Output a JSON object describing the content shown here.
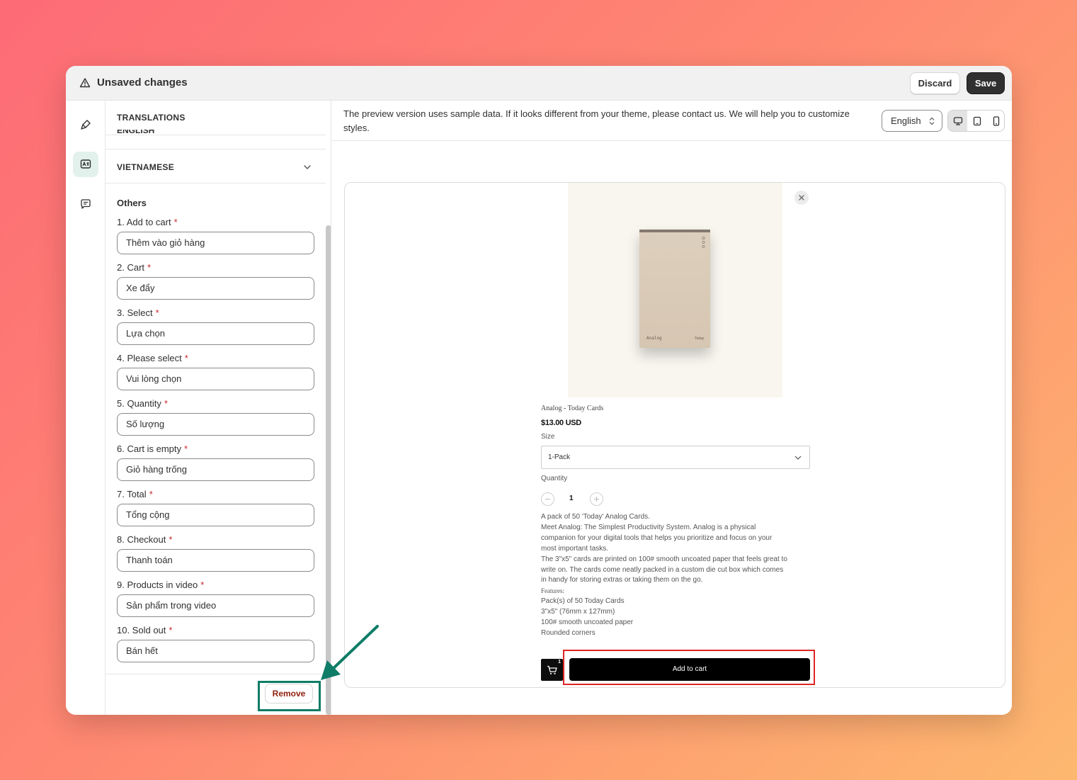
{
  "topbar": {
    "title": "Unsaved changes",
    "discard_label": "Discard",
    "save_label": "Save"
  },
  "rail": {
    "items": [
      {
        "icon": "paintbrush-icon",
        "active": false
      },
      {
        "icon": "translate-icon",
        "active": true
      },
      {
        "icon": "chat-icon",
        "active": false
      }
    ]
  },
  "panel": {
    "heading": "TRANSLATIONS",
    "collapsed_section": "ENGLISH",
    "section": "VIETNAMESE",
    "group_title": "Others",
    "fields": [
      {
        "label": "1. Add to cart",
        "value": "Thêm vào giỏ hàng"
      },
      {
        "label": "2. Cart",
        "value": "Xe đẩy"
      },
      {
        "label": "3. Select",
        "value": "Lựa chọn"
      },
      {
        "label": "4. Please select",
        "value": "Vui lòng chọn"
      },
      {
        "label": "5. Quantity",
        "value": "Số lượng"
      },
      {
        "label": "6. Cart is empty",
        "value": "Giỏ hàng trống"
      },
      {
        "label": "7. Total",
        "value": "Tổng cộng"
      },
      {
        "label": "8. Checkout",
        "value": "Thanh toán"
      },
      {
        "label": "9. Products in video",
        "value": "Sản phẩm trong video"
      },
      {
        "label": "10. Sold out",
        "value": "Bán hết"
      }
    ],
    "required_mark": "*",
    "remove_label": "Remove"
  },
  "preview": {
    "notice": "The preview version uses sample data. If it looks different from your theme, please contact us. We will help you to customize styles.",
    "language": "English",
    "devices": [
      "desktop-icon",
      "tablet-icon",
      "mobile-icon"
    ],
    "product": {
      "image_brand": "Analog",
      "image_sub": "Today",
      "title": "Analog - Today Cards",
      "price": "$13.00 USD",
      "size_label": "Size",
      "size_value": "1-Pack",
      "quantity_label": "Quantity",
      "quantity_value": "1",
      "description": [
        "A pack of 50 'Today' Analog Cards.",
        "Meet Analog: The Simplest Productivity System. Analog is a physical",
        "companion for your digital tools that helps you prioritize and focus on your",
        "most important tasks.",
        "The 3\"x5\" cards are printed on 100# smooth uncoated paper that feels great to",
        "write on. The cards come neatly packed in a custom die cut box which comes",
        "in handy for storing extras or taking them on the go.",
        "Features:",
        "Pack(s) of 50 Today Cards",
        "3\"x5\" (76mm x 127mm)",
        "100# smooth uncoated paper",
        "Rounded corners"
      ],
      "cart_count": "1",
      "add_to_cart_label": "Add to cart"
    }
  },
  "colors": {
    "highlight_red": "#e02424",
    "highlight_green": "#0e7c66",
    "required": "#c5282c",
    "remove_text": "#8e1f0b"
  }
}
